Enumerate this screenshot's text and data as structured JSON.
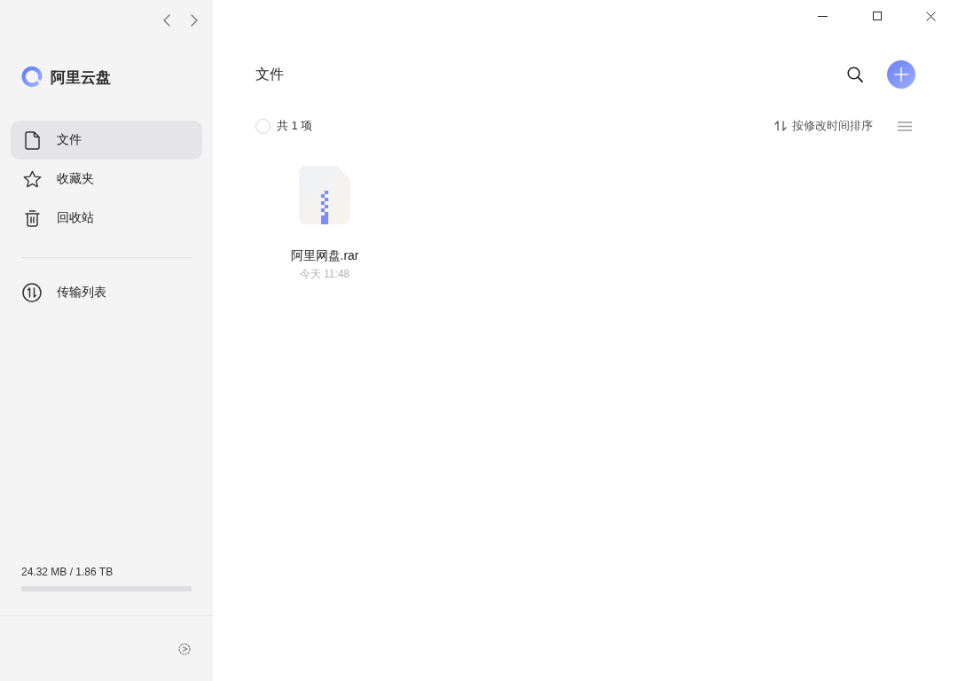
{
  "sidebar": {
    "app_name": "阿里云盘",
    "nav_items": [
      {
        "label": "文件",
        "selected": true
      },
      {
        "label": "收藏夹",
        "selected": false
      },
      {
        "label": "回收站",
        "selected": false
      }
    ],
    "secondary_items": [
      {
        "label": "传输列表",
        "selected": false
      }
    ],
    "storage": {
      "reading": "24.32 MB / 1.86 TB",
      "level": 0
    }
  },
  "main": {
    "title": "文件",
    "select_all": {
      "checked": false
    },
    "count_label": "共 1 项",
    "sort_label": "按修改时间排序",
    "files": [
      {
        "name": "阿里网盘.rar",
        "date": "今天 11:48",
        "selected": false
      }
    ]
  }
}
